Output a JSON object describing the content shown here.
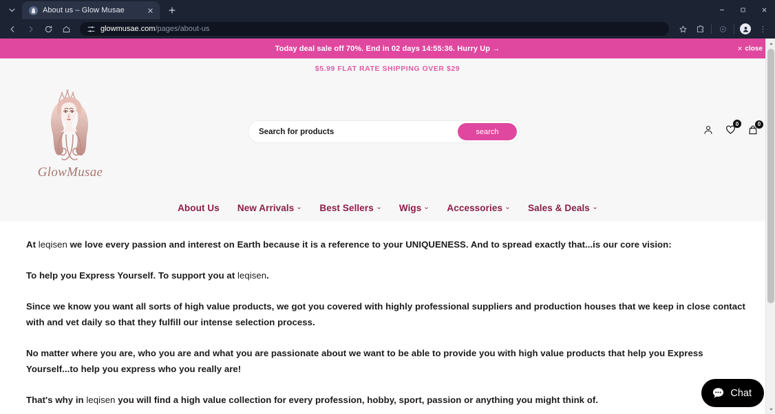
{
  "browser": {
    "tab": {
      "title": "About us – Glow Musae",
      "favicon": "shopify-favicon",
      "close": "×"
    },
    "new_tab_label": "+",
    "window": {
      "minimize": "–",
      "maximize": "▢",
      "close": "✕"
    },
    "nav_buttons": {
      "back": "back-arrow",
      "forward": "forward-arrow",
      "reload": "reload-icon",
      "home": "home-icon"
    },
    "omnibox": {
      "domain": "glowmusae.com",
      "path": "/pages/about-us",
      "site_settings_icon": "tune-icon"
    },
    "toolbar_right": [
      "bookmark-star-icon",
      "extensions-icon",
      "devices-icon",
      "profile-avatar-icon",
      "chrome-menu-icon"
    ]
  },
  "announcement": {
    "text": "Today deal sale off 70%. End in 02 days 14:55:36. Hurry Up →",
    "close_label": "close",
    "bg_color": "#e0479e"
  },
  "shipping_bar": {
    "text": "$5.99 FLAT RATE SHIPPING OVER $29",
    "color": "#e05ba4"
  },
  "header": {
    "logo": {
      "wordmark": "GlowMusae",
      "art": "woman-with-crown-illustration"
    },
    "search": {
      "placeholder": "Search for products",
      "value": "",
      "button_label": "search"
    },
    "icons": [
      {
        "name": "account-icon",
        "badge": null
      },
      {
        "name": "wishlist-heart-icon",
        "badge": "0"
      },
      {
        "name": "cart-bag-icon",
        "badge": "0"
      }
    ],
    "nav": [
      {
        "label": "About Us",
        "has_dropdown": false
      },
      {
        "label": "New Arrivals",
        "has_dropdown": true
      },
      {
        "label": "Best Sellers",
        "has_dropdown": true
      },
      {
        "label": "Wigs",
        "has_dropdown": true
      },
      {
        "label": "Accessories",
        "has_dropdown": true
      },
      {
        "label": "Sales & Deals",
        "has_dropdown": true
      }
    ],
    "nav_color": "#8e1c48"
  },
  "content": {
    "paragraphs": [
      {
        "before": "At ",
        "brand": "leqisen",
        "after": " we love every passion and interest on Earth because it is a reference to your UNIQUENESS. And to spread exactly that...is our core vision:"
      },
      {
        "before": "To help you Express Yourself. To support you at ",
        "brand": "leqisen",
        "after": "."
      },
      {
        "before": "Since we know you want all sorts of high value products, we got you covered with highly professional suppliers and production houses that we keep in close contact with and vet daily so that they fulfill our intense selection process.",
        "brand": "",
        "after": ""
      },
      {
        "before": "No matter where you are, who you are and what you are passionate about we want to be able to provide you with high value products that help you Express Yourself...to help you express who you really are!",
        "brand": "",
        "after": ""
      },
      {
        "before": "That's why in ",
        "brand": "leqisen",
        "after": " you will find a high value collection for every profession, hobby, sport, passion or anything you might think of."
      }
    ]
  },
  "chat_widget": {
    "label": "Chat",
    "icon": "chat-bubble-icon",
    "bg_color": "#000000"
  },
  "scrollbar": {
    "up_arrow": "▲",
    "down_arrow": "▼"
  }
}
